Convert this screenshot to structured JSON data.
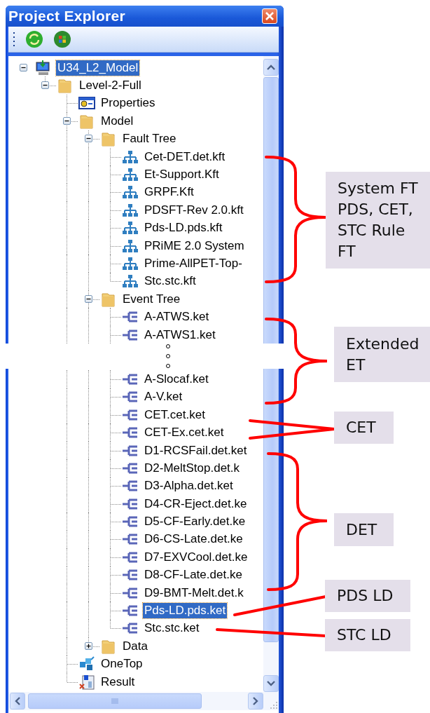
{
  "window": {
    "title": "Project Explorer"
  },
  "tree": {
    "label": "U34_L2_Model",
    "kind": "computer",
    "selected": true,
    "expanded": true,
    "children": [
      {
        "label": "Level-2-Full",
        "kind": "folder",
        "selected": false,
        "expanded": true,
        "children": [
          {
            "label": "Properties",
            "kind": "properties",
            "selected": false
          },
          {
            "label": "Model",
            "kind": "folder",
            "selected": false,
            "expanded": true,
            "children": [
              {
                "label": "Fault Tree",
                "kind": "folder",
                "selected": false,
                "expanded": true,
                "children": [
                  {
                    "label": "Cet-DET.det.kft",
                    "kind": "fault_tree",
                    "selected": false
                  },
                  {
                    "label": "Et-Support.Kft",
                    "kind": "fault_tree",
                    "selected": false
                  },
                  {
                    "label": "GRPF.Kft",
                    "kind": "fault_tree",
                    "selected": false
                  },
                  {
                    "label": "PDSFT-Rev 2.0.kft",
                    "kind": "fault_tree",
                    "selected": false
                  },
                  {
                    "label": "Pds-LD.pds.kft",
                    "kind": "fault_tree",
                    "selected": false
                  },
                  {
                    "label": "PRiME 2.0 System",
                    "kind": "fault_tree",
                    "selected": false
                  },
                  {
                    "label": "Prime-AllPET-Top-",
                    "kind": "fault_tree",
                    "selected": false
                  },
                  {
                    "label": "Stc.stc.kft",
                    "kind": "fault_tree",
                    "selected": false
                  }
                ]
              },
              {
                "label": "Event Tree",
                "kind": "folder",
                "selected": false,
                "expanded": true,
                "children": [
                  {
                    "label": "A-ATWS.ket",
                    "kind": "event_tree",
                    "selected": false
                  },
                  {
                    "label": "A-ATWS1.ket",
                    "kind": "event_tree",
                    "selected": false
                  },
                  {
                    "label": "A-Slocaf.ket",
                    "kind": "event_tree",
                    "selected": false,
                    "break_before": true
                  },
                  {
                    "label": "A-V.ket",
                    "kind": "event_tree",
                    "selected": false
                  },
                  {
                    "label": "CET.cet.ket",
                    "kind": "event_tree",
                    "selected": false
                  },
                  {
                    "label": "CET-Ex.cet.ket",
                    "kind": "event_tree",
                    "selected": false
                  },
                  {
                    "label": "D1-RCSFail.det.ket",
                    "kind": "event_tree",
                    "selected": false
                  },
                  {
                    "label": "D2-MeltStop.det.k",
                    "kind": "event_tree",
                    "selected": false
                  },
                  {
                    "label": "D3-Alpha.det.ket",
                    "kind": "event_tree",
                    "selected": false
                  },
                  {
                    "label": "D4-CR-Eject.det.ke",
                    "kind": "event_tree",
                    "selected": false
                  },
                  {
                    "label": "D5-CF-Early.det.ke",
                    "kind": "event_tree",
                    "selected": false
                  },
                  {
                    "label": "D6-CS-Late.det.ke",
                    "kind": "event_tree",
                    "selected": false
                  },
                  {
                    "label": "D7-EXVCool.det.ke",
                    "kind": "event_tree",
                    "selected": false
                  },
                  {
                    "label": "D8-CF-Late.det.ke",
                    "kind": "event_tree",
                    "selected": false
                  },
                  {
                    "label": "D9-BMT-Melt.det.k",
                    "kind": "event_tree",
                    "selected": false
                  },
                  {
                    "label": "Pds-LD.pds.ket",
                    "kind": "event_tree",
                    "selected": true
                  },
                  {
                    "label": "Stc.stc.ket",
                    "kind": "event_tree",
                    "selected": false
                  }
                ]
              },
              {
                "label": "Data",
                "kind": "folder",
                "selected": false,
                "expanded": false
              }
            ]
          },
          {
            "label": "OneTop",
            "kind": "onetop",
            "selected": false
          },
          {
            "label": "Result",
            "kind": "result",
            "selected": false
          }
        ]
      }
    ]
  },
  "annotations": [
    {
      "kind": "brace",
      "label": "System FT\nPDS, CET,\nSTC Rule\nFT"
    },
    {
      "kind": "brace",
      "label": "Extended\nET"
    },
    {
      "kind": "fork",
      "label": "CET"
    },
    {
      "kind": "brace",
      "label": "DET"
    },
    {
      "kind": "line",
      "label": "PDS LD"
    },
    {
      "kind": "line",
      "label": "STC LD"
    }
  ]
}
